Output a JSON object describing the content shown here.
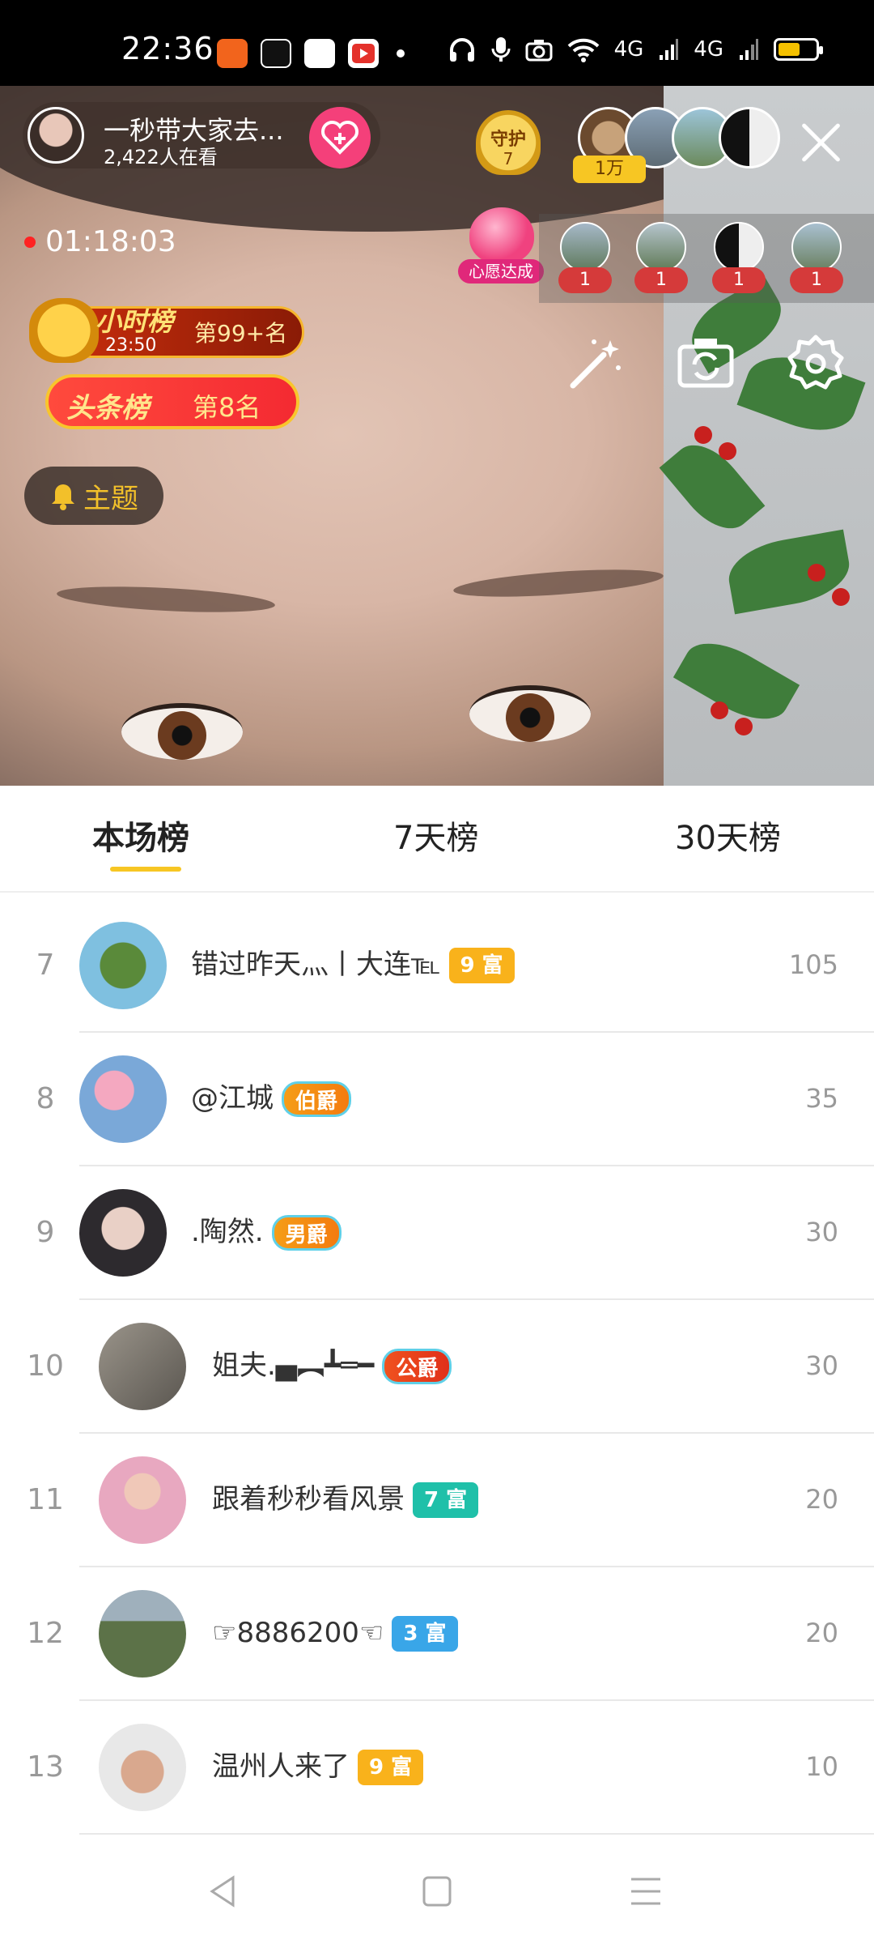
{
  "status_bar": {
    "time": "22:36",
    "signal_1": "4G",
    "signal_2": "4G"
  },
  "live": {
    "host_name": "一秒带大家去...",
    "viewers": "2,422人在看",
    "guard_label": "守护",
    "guard_count": "7",
    "top_badge": "1万",
    "timer": "01:18:03",
    "wish_label": "心愿达成",
    "mic_counts": [
      "1",
      "1",
      "1",
      "1"
    ],
    "hour_rank_label": "小时榜",
    "hour_rank_time": "23:50",
    "hour_rank_value": "第99+名",
    "headline_label": "头条榜",
    "headline_value": "第8名",
    "theme_label": "主题"
  },
  "tabs": [
    {
      "label": "本场榜",
      "active": true
    },
    {
      "label": "7天榜",
      "active": false
    },
    {
      "label": "30天榜",
      "active": false
    }
  ],
  "leaderboard": [
    {
      "rank": "7",
      "name": "错过昨天灬丨大连℡",
      "badge": "9 富",
      "badge_style": "gold",
      "score": "105"
    },
    {
      "rank": "8",
      "name": "@江城",
      "badge": "伯爵",
      "badge_style": "title",
      "score": "35"
    },
    {
      "rank": "9",
      "name": ".陶然.",
      "badge": "男爵",
      "badge_style": "title",
      "score": "30"
    },
    {
      "rank": "10",
      "name": "姐夫.▄︻┻═━",
      "badge": "公爵",
      "badge_style": "title",
      "score": "30"
    },
    {
      "rank": "11",
      "name": "跟着秒秒看风景",
      "badge": "7 富",
      "badge_style": "teal",
      "score": "20"
    },
    {
      "rank": "12",
      "name": "☞8886200☜",
      "badge": "3 富",
      "badge_style": "blue",
      "score": "20"
    },
    {
      "rank": "13",
      "name": "温州人来了",
      "badge": "9 富",
      "badge_style": "gold",
      "score": "10"
    }
  ],
  "colors": {
    "accent": "#f7c623",
    "follow": "#f4407a",
    "badge_gold": "#f9b21b",
    "badge_teal": "#1fc0a9",
    "badge_blue": "#39a6e8"
  },
  "icons": [
    "back-icon",
    "home-icon",
    "menu-icon",
    "magic-wand-icon",
    "camera-switch-icon",
    "settings-icon",
    "bell-icon",
    "close-icon",
    "heart-plus-icon"
  ]
}
